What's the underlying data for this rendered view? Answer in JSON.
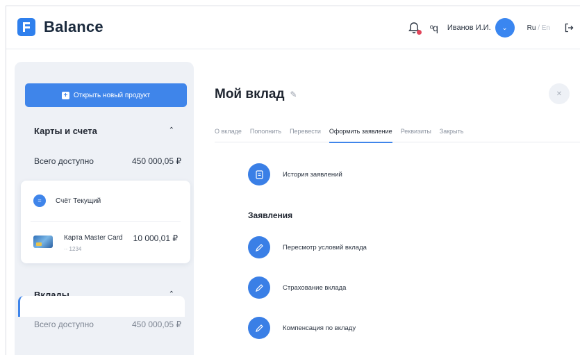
{
  "header": {
    "logo_text": "Balance",
    "user_name": "Иванов И.И.",
    "lang_active": "Ru",
    "lang_sep": "/",
    "lang_other": "En",
    "link_glyph": "ᵒq",
    "icons": [
      "bell-icon",
      "link-icon",
      "chevron-down-icon",
      "logout-icon"
    ],
    "notification_color": "#e2455a"
  },
  "sidebar": {
    "new_product_label": "Открыть новый продукт",
    "cards": {
      "title": "Карты и счета",
      "available_label": "Всего доступно",
      "available_value": "450 000,05 ₽",
      "account_name": "Счёт Текущий",
      "card_name": "Карта Master Card",
      "card_number": "·· 1234",
      "card_amount": "10 000,01 ₽"
    },
    "deposits": {
      "title": "Вклады",
      "available_label": "Всего доступно",
      "available_value": "450 000,05 ₽"
    }
  },
  "main": {
    "title": "Мой вклад",
    "tabs": [
      {
        "label": "О вкладе"
      },
      {
        "label": "Пополнить"
      },
      {
        "label": "Перевести"
      },
      {
        "label": "Оформить заявление",
        "active": true
      },
      {
        "label": "Реквизиты"
      },
      {
        "label": "Закрыть"
      }
    ],
    "history_label": "История заявлений",
    "section_title": "Заявления",
    "applications": [
      {
        "label": "Пересмотр условий вклада"
      },
      {
        "label": "Страхование вклада"
      },
      {
        "label": "Компенсация по вкладу"
      }
    ]
  },
  "colors": {
    "accent": "#3f85ea",
    "sidebar_bg": "#eef1f6"
  }
}
